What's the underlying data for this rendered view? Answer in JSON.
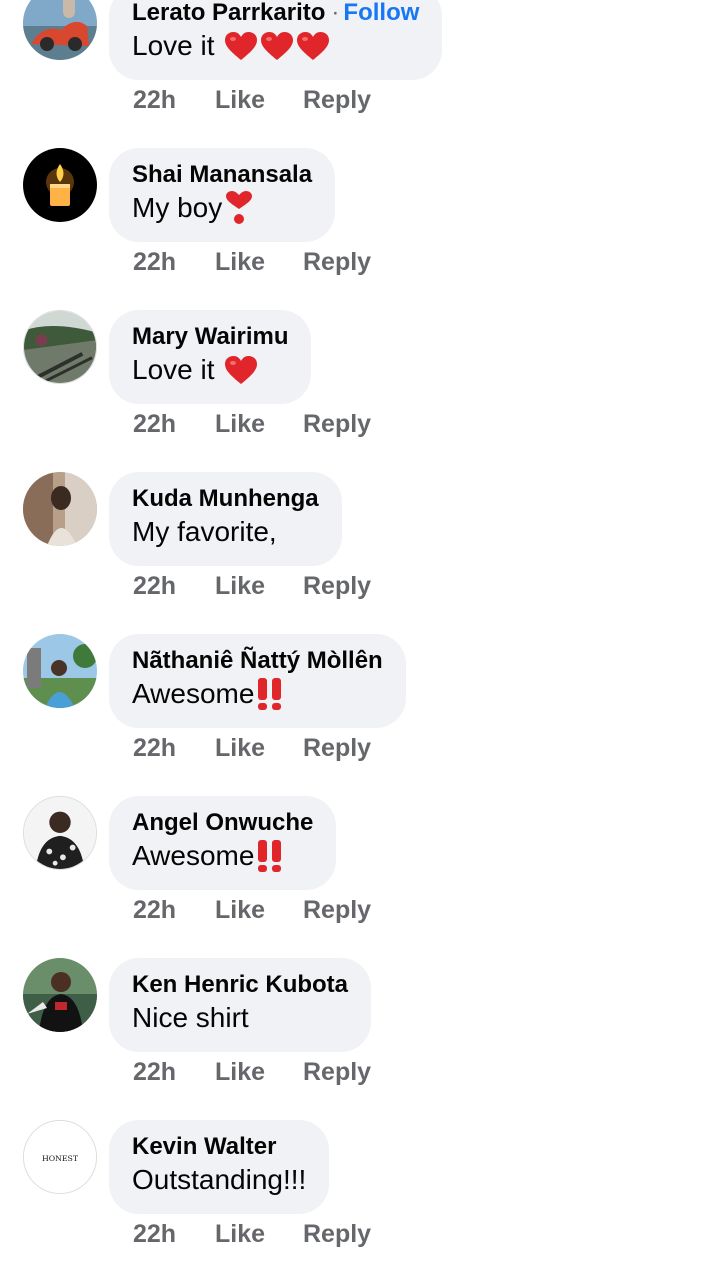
{
  "comments": [
    {
      "name": "Lerato Parrkarito",
      "separator": "·",
      "follow_label": "Follow",
      "text": "Love it",
      "emoji": "heart-icon",
      "emoji_count": 3,
      "time": "22h",
      "like_label": "Like",
      "reply_label": "Reply"
    },
    {
      "name": "Shai Manansala",
      "text": "My boy",
      "emoji": "heavy-heart-exclamation-icon",
      "emoji_count": 1,
      "time": "22h",
      "like_label": "Like",
      "reply_label": "Reply"
    },
    {
      "name": "Mary Wairimu",
      "text": "Love it ",
      "emoji": "heart-icon",
      "emoji_count": 1,
      "time": "22h",
      "like_label": "Like",
      "reply_label": "Reply"
    },
    {
      "name": "Kuda Munhenga",
      "text": "My favorite,",
      "emoji": "",
      "emoji_count": 0,
      "time": "22h",
      "like_label": "Like",
      "reply_label": "Reply"
    },
    {
      "name": "Nãthaniê Ñattý Mòllên",
      "text": "Awesome",
      "emoji": "double-exclamation-icon",
      "emoji_count": 1,
      "time": "22h",
      "like_label": "Like",
      "reply_label": "Reply"
    },
    {
      "name": "Angel Onwuche",
      "text": "Awesome",
      "emoji": "double-exclamation-icon",
      "emoji_count": 1,
      "time": "22h",
      "like_label": "Like",
      "reply_label": "Reply"
    },
    {
      "name": "Ken Henric Kubota",
      "text": "Nice shirt",
      "emoji": "",
      "emoji_count": 0,
      "time": "22h",
      "like_label": "Like",
      "reply_label": "Reply"
    },
    {
      "name": "Kevin Walter",
      "text": "Outstanding!!!",
      "emoji": "",
      "emoji_count": 0,
      "time": "22h",
      "like_label": "Like",
      "reply_label": "Reply",
      "avatar_logo_text": "HONEST"
    }
  ],
  "colors": {
    "bubble": "#f0f2f5",
    "name": "#050505",
    "meta": "#65676b",
    "follow": "#1877f2",
    "emoji_red": "#e0262b"
  }
}
